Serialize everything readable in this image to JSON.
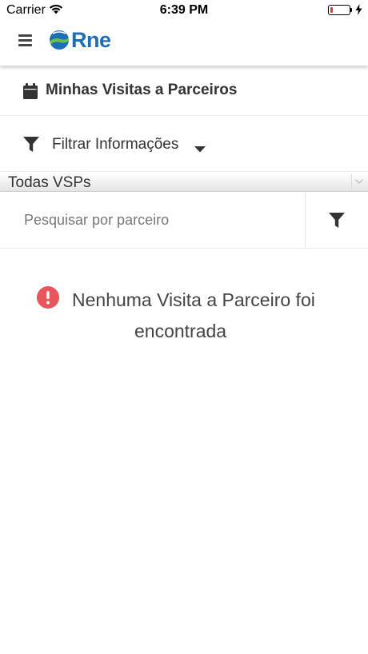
{
  "status_bar": {
    "carrier": "Carrier",
    "time": "6:39 PM",
    "battery_level": 0.15
  },
  "header": {
    "logo_text": "Rne"
  },
  "page": {
    "title": "Minhas Visitas a Parceiros"
  },
  "filter": {
    "label": "Filtrar Informações"
  },
  "select": {
    "value": "Todas VSPs"
  },
  "search": {
    "placeholder": "Pesquisar por parceiro",
    "value": ""
  },
  "empty_state": {
    "message_line1": "Nenhuma Visita a Parceiro foi",
    "message_line2": "encontrada"
  },
  "colors": {
    "brand_blue": "#1d6fb5",
    "brand_green": "#6cc04a",
    "alert_red": "#e9555c",
    "battery_red": "#e53935"
  },
  "icons": {
    "menu": "hamburger-icon",
    "calendar": "calendar-icon",
    "filter": "funnel-icon",
    "caret": "caret-down-icon",
    "alert": "exclamation-circle-icon"
  }
}
